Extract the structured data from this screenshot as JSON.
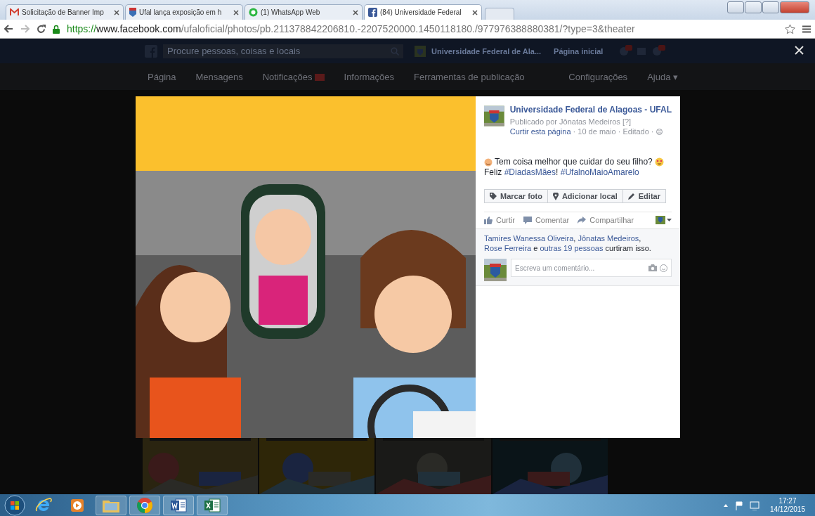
{
  "browser": {
    "tabs": [
      {
        "kind": "mail",
        "title": "Solicitação de Banner Imp",
        "selected": false
      },
      {
        "kind": "page",
        "title": "Ufal lança exposição em h",
        "selected": false
      },
      {
        "kind": "chat",
        "title": "(1) WhatsApp Web",
        "selected": false
      },
      {
        "kind": "facebook",
        "title": "(84) Universidade Federal",
        "selected": true
      }
    ],
    "url": {
      "scheme": "https://",
      "host": "www.facebook.com",
      "path": "/ufaloficial/photos/pb.211378842206810.-2207520000.1450118180./977976388880381/?type=3&theater"
    }
  },
  "facebook_bar": {
    "search_placeholder": "Procure pessoas, coisas e locais",
    "page_name": "Universidade Federal de Ala...",
    "home": "Página inicial"
  },
  "page_nav": {
    "left": [
      {
        "label": "Página",
        "badge": false
      },
      {
        "label": "Mensagens",
        "badge": false
      },
      {
        "label": "Notificações",
        "badge": true
      },
      {
        "label": "Informações",
        "badge": false
      },
      {
        "label": "Ferramentas de publicação",
        "badge": false
      }
    ],
    "right": [
      "Configurações",
      "Ajuda ▾"
    ]
  },
  "post": {
    "page_name": "Universidade Federal de Alagoas - UFAL",
    "published_by": "Publicado por Jônatas Medeiros",
    "help": "[?]",
    "meta": [
      {
        "text": "Curtir esta página",
        "link": true
      },
      {
        "text": " · 10 de maio · Editado · ",
        "link": false
      }
    ],
    "message_line": "Tem coisa melhor que cuidar do seu filho?",
    "message_parts": [
      {
        "text": "Feliz ",
        "link": false
      },
      {
        "text": "#DiadasMães",
        "link": true
      },
      {
        "text": "! ",
        "link": false
      },
      {
        "text": "#UfalnoMaioAmarelo",
        "link": true
      }
    ],
    "actions": [
      {
        "kind": "tag",
        "label": "Marcar foto"
      },
      {
        "kind": "pin",
        "label": "Adicionar local"
      },
      {
        "kind": "pencil",
        "label": "Editar"
      }
    ],
    "footer": [
      {
        "kind": "like",
        "label": "Curtir"
      },
      {
        "kind": "comment",
        "label": "Comentar"
      },
      {
        "kind": "share",
        "label": "Compartilhar"
      }
    ],
    "likes": [
      {
        "text": "Tamires Wanessa Oliveira",
        "link": true
      },
      {
        "text": ", ",
        "link": false
      },
      {
        "text": "Jônatas Medeiros",
        "link": true
      },
      {
        "text": ", ",
        "link": false
      },
      {
        "text": "Rose Ferreira",
        "link": true
      },
      {
        "text": " e ",
        "link": false
      },
      {
        "text": "outras 19 pessoas",
        "link": true
      },
      {
        "text": " curtiram isso.",
        "link": false
      }
    ],
    "comment_placeholder": "Escreva um comentário..."
  },
  "taskbar": {
    "apps": [
      {
        "kind": "ie"
      },
      {
        "kind": "media"
      },
      {
        "kind": "folder"
      },
      {
        "kind": "chrome"
      },
      {
        "kind": "word"
      },
      {
        "kind": "excel"
      }
    ],
    "time": "17:27",
    "date": "14/12/2015"
  }
}
